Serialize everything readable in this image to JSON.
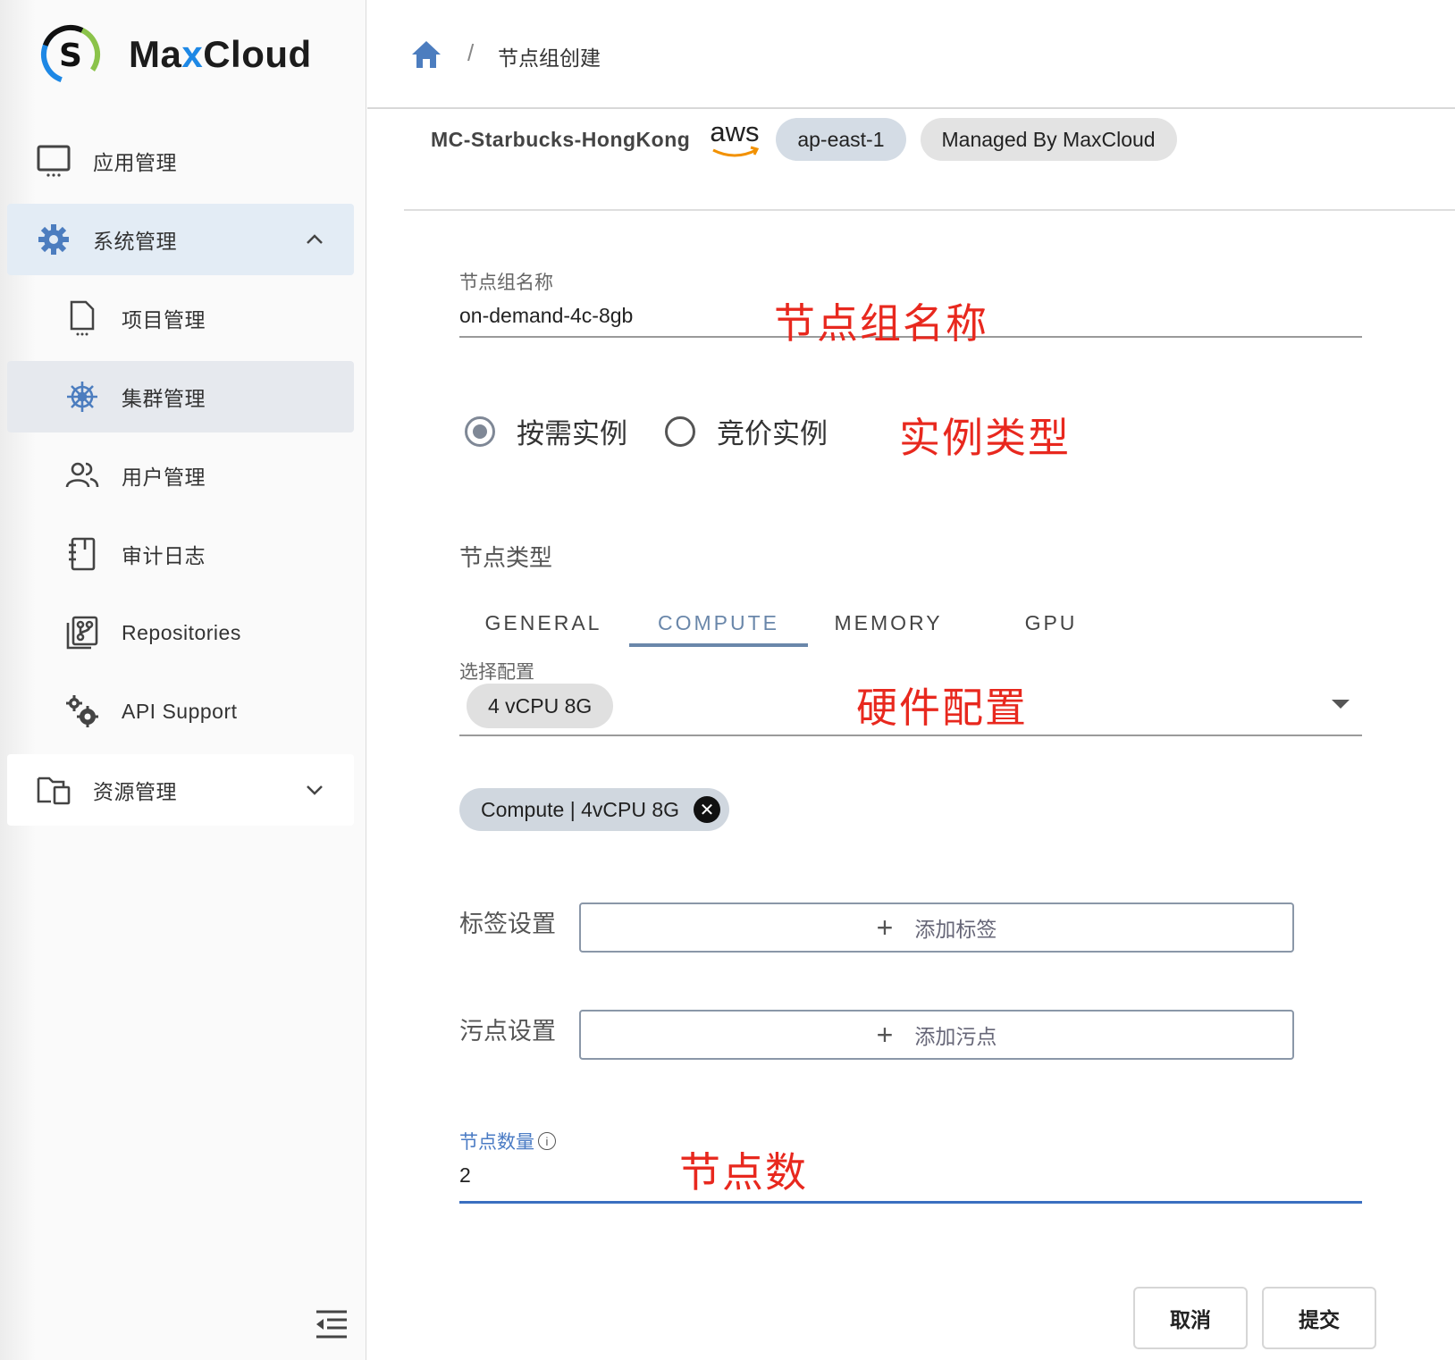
{
  "app": {
    "brand_prefix": "Ma",
    "brand_x": "x",
    "brand_suffix": "Cloud"
  },
  "sidebar": {
    "items": [
      {
        "label": "应用管理",
        "icon": "monitor-icon"
      },
      {
        "label": "系统管理",
        "icon": "gear-icon",
        "expanded": true
      },
      {
        "label": "项目管理",
        "icon": "document-icon"
      },
      {
        "label": "集群管理",
        "icon": "helm-icon",
        "selected": true
      },
      {
        "label": "用户管理",
        "icon": "users-icon"
      },
      {
        "label": "审计日志",
        "icon": "notebook-icon"
      },
      {
        "label": "Repositories",
        "icon": "repository-icon"
      },
      {
        "label": "API Support",
        "icon": "cogs-icon"
      },
      {
        "label": "资源管理",
        "icon": "folders-icon",
        "expanded": false
      }
    ],
    "collapse_icon": "menu-collapse-icon"
  },
  "breadcrumb": {
    "separator": "/",
    "current": "节点组创建"
  },
  "cluster": {
    "name": "MC-Starbucks-HongKong",
    "provider": "aws",
    "region": "ap-east-1",
    "managed": "Managed By MaxCloud"
  },
  "form": {
    "name_label": "节点组名称",
    "name_value": "on-demand-4c-8gb",
    "instance_options": [
      "按需实例",
      "竞价实例"
    ],
    "instance_selected": "按需实例",
    "node_type_title": "节点类型",
    "tabs": [
      "GENERAL",
      "COMPUTE",
      "MEMORY",
      "GPU"
    ],
    "active_tab": "COMPUTE",
    "config_label": "选择配置",
    "config_value": "4 vCPU 8G",
    "selected_chip": "Compute | 4vCPU 8G",
    "labels_title": "标签设置",
    "add_label": "添加标签",
    "taints_title": "污点设置",
    "add_taint": "添加污点",
    "count_label": "节点数量",
    "count_value": "2"
  },
  "annotations": {
    "name": "节点组名称",
    "instance": "实例类型",
    "hardware": "硬件配置",
    "count": "节点数"
  },
  "actions": {
    "cancel": "取消",
    "submit": "提交"
  },
  "colors": {
    "accent": "#6a87aa",
    "annotation": "#e8281e",
    "focus": "#3a6fc0"
  }
}
